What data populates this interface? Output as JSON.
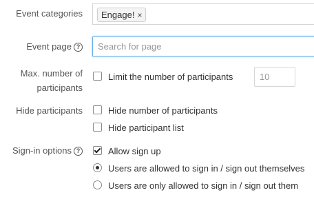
{
  "event_categories": {
    "label": "Event categories",
    "tags": [
      {
        "label": "Engage!",
        "remove_icon": "×"
      }
    ]
  },
  "event_page": {
    "label": "Event page",
    "help_icon": "?",
    "search_placeholder": "Search for page"
  },
  "max_participants": {
    "label_line1": "Max. number of",
    "label_line2": "participants",
    "checkbox_label": "Limit the number of participants",
    "checked": false,
    "number_placeholder": "10"
  },
  "hide_participants": {
    "label": "Hide participants",
    "options": [
      {
        "label": "Hide number of participants",
        "checked": false
      },
      {
        "label": "Hide participant list",
        "checked": false
      }
    ]
  },
  "signin_options": {
    "label": "Sign-in options",
    "help_icon": "?",
    "allow_signup": {
      "label": "Allow sign up",
      "checked": true
    },
    "radios": [
      {
        "label": "Users are allowed to sign in / sign out themselves",
        "selected": true
      },
      {
        "label": "Users are only allowed to sign in / sign out them",
        "selected": false
      }
    ]
  },
  "colors": {
    "focus_border": "#66afe9",
    "label_text": "#555555",
    "placeholder_text": "#999999"
  }
}
